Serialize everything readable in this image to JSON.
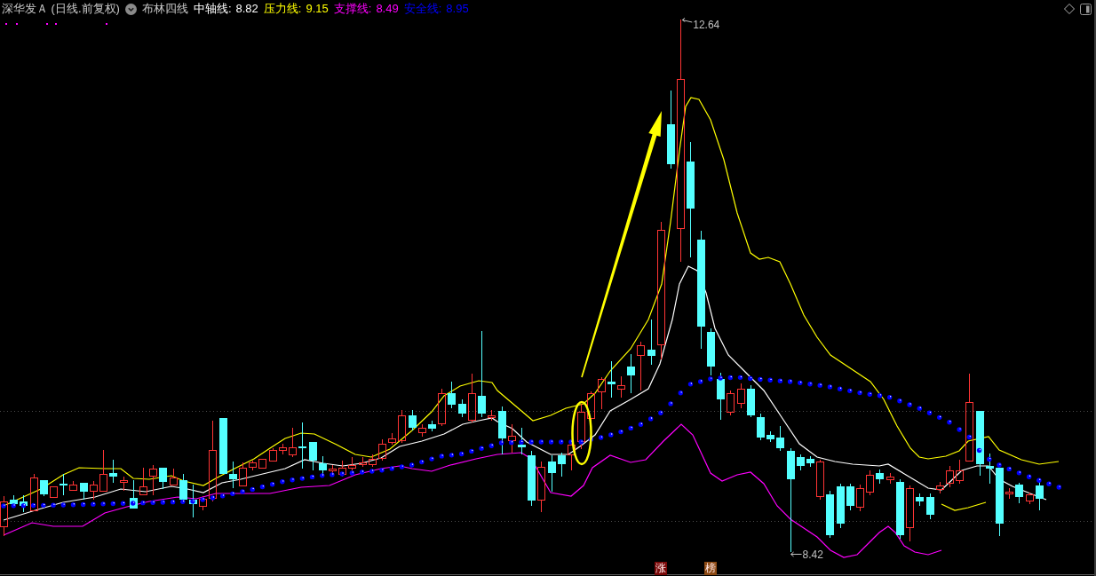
{
  "header": {
    "title": "深华发Ａ (日线.前复权)",
    "indicator": "布林四线",
    "readings": [
      {
        "label": "中轴线:",
        "value": "8.82",
        "color": "#ffffff"
      },
      {
        "label": "压力线:",
        "value": "9.15",
        "color": "#ffff00"
      },
      {
        "label": "支撑线:",
        "value": "8.49",
        "color": "#ff00ff"
      },
      {
        "label": "安全线:",
        "value": "8.95",
        "color": "#0000ff"
      }
    ]
  },
  "chart": {
    "high_label": "12.64",
    "low_label": "8.42",
    "badges": [
      {
        "text": "涨",
        "color": "#7a0a0a"
      },
      {
        "text": "榜",
        "color": "#8c4a14"
      }
    ]
  }
}
